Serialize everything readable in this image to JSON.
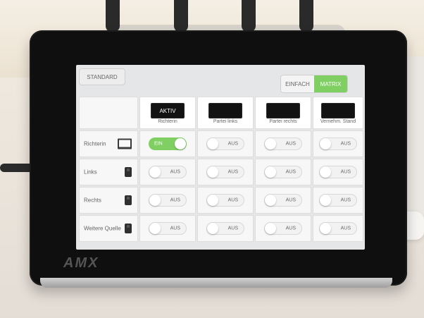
{
  "panel": {
    "brand": "AMX",
    "buttons": {
      "standard": "STANDARD",
      "mode_left": "EINFACH",
      "mode_right": "MATRIX"
    },
    "columns": [
      {
        "status": "AKTIV",
        "label": "Richterin"
      },
      {
        "status": "",
        "label": "Partei links"
      },
      {
        "status": "",
        "label": "Partei rechts"
      },
      {
        "status": "",
        "label": "Vernehm. Stand"
      }
    ],
    "rows": [
      {
        "label": "Richterin",
        "icon": "laptop-icon"
      },
      {
        "label": "Links",
        "icon": "hdmi-plug-icon"
      },
      {
        "label": "Rechts",
        "icon": "hdmi-plug-icon"
      },
      {
        "label": "Weitere Quelle",
        "icon": "hdmi-plug-icon"
      }
    ],
    "matrix": [
      [
        "EIN",
        "AUS",
        "AUS",
        "AUS"
      ],
      [
        "AUS",
        "AUS",
        "AUS",
        "AUS"
      ],
      [
        "AUS",
        "AUS",
        "AUS",
        "AUS"
      ],
      [
        "AUS",
        "AUS",
        "AUS",
        "AUS"
      ]
    ],
    "colors": {
      "accent_on": "#7fcf62"
    }
  }
}
